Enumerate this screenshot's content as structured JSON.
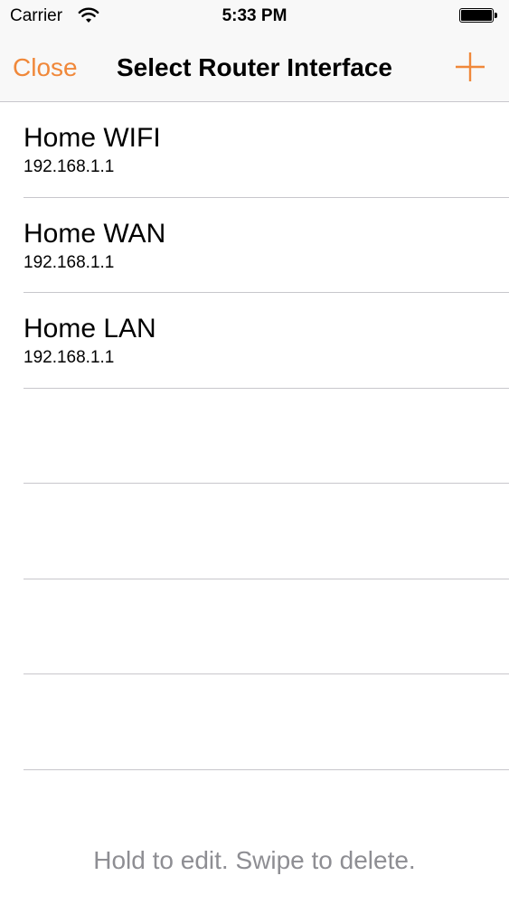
{
  "status_bar": {
    "carrier": "Carrier",
    "time": "5:33 PM"
  },
  "nav_bar": {
    "close_label": "Close",
    "title": "Select Router Interface",
    "add_icon": "plus-icon"
  },
  "interfaces": [
    {
      "name": "Home WIFI",
      "address": "192.168.1.1"
    },
    {
      "name": "Home WAN",
      "address": "192.168.1.1"
    },
    {
      "name": "Home LAN",
      "address": "192.168.1.1"
    }
  ],
  "footer": {
    "hint": "Hold to edit. Swipe to delete."
  },
  "colors": {
    "accent": "#f0883a",
    "separator": "#c8c7cc",
    "hint_text": "#8e8e93",
    "nav_background": "#f8f8f8"
  }
}
